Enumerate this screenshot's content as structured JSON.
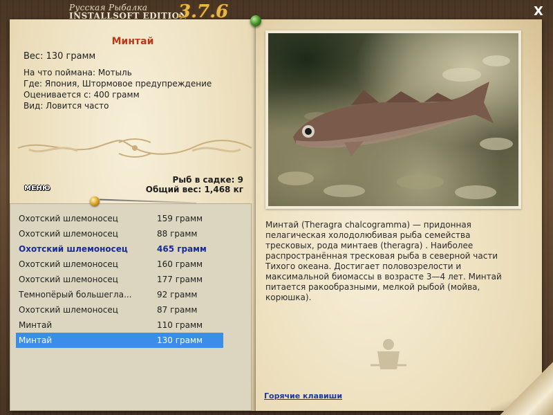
{
  "window": {
    "title_small": "Русская Рыбалка",
    "title_main": "INSTALLSOFT EDITION",
    "version": "3.7.6",
    "close_label": "X"
  },
  "catch": {
    "fish_name": "Минтай",
    "weight": "Вес: 130 грамм",
    "bait": "На что поймана: Мотыль",
    "location": "Где: Япония, Штормовое предупреждение",
    "valued_from": "Оценивается с: 400 грамм",
    "frequency": "Вид: Ловится часто"
  },
  "keepnet": {
    "count_label": "Рыб в садке: 9",
    "total_label": "Общий вес: 1,468 кг"
  },
  "menu_label": "МЕНЮ",
  "fish_list": [
    {
      "name": "Охотский шлемоносец",
      "weight": "159 грамм",
      "style": "normal"
    },
    {
      "name": "Охотский шлемоносец",
      "weight": "88 грамм",
      "style": "normal"
    },
    {
      "name": "Охотский шлемоносец",
      "weight": "465 грамм",
      "style": "bold"
    },
    {
      "name": "Охотский шлемоносец",
      "weight": "160 грамм",
      "style": "normal"
    },
    {
      "name": "Охотский шлемоносец",
      "weight": "177 грамм",
      "style": "normal"
    },
    {
      "name": "Темнопёрый большегла...",
      "weight": "92 грамм",
      "style": "normal"
    },
    {
      "name": "Охотский шлемоносец",
      "weight": "87 грамм",
      "style": "normal"
    },
    {
      "name": "Минтай",
      "weight": "110 грамм",
      "style": "normal"
    },
    {
      "name": "Минтай",
      "weight": "130 грамм",
      "style": "selected"
    }
  ],
  "description": "Минтай (Theragra chalcogramma) — придонная пелагическая холодолюбивая рыба семейства тресковых, рода минтаев (theragra) . Наиболее распространённая тресковая рыба в северной части Тихого океана. Достигает половозрелости и максимальной биомассы в возрасте 3—4 лет. Минтай питается ракообразными, мелкой рыбой (мойва, корюшка).",
  "hotkeys_label": "Горячие клавиши",
  "colors": {
    "fish_name": "#b8381a",
    "highlight_text": "#1a2a9a",
    "selected_row": "#3a8ee8",
    "link": "#1a3a9a",
    "version": "#e6b84a"
  }
}
